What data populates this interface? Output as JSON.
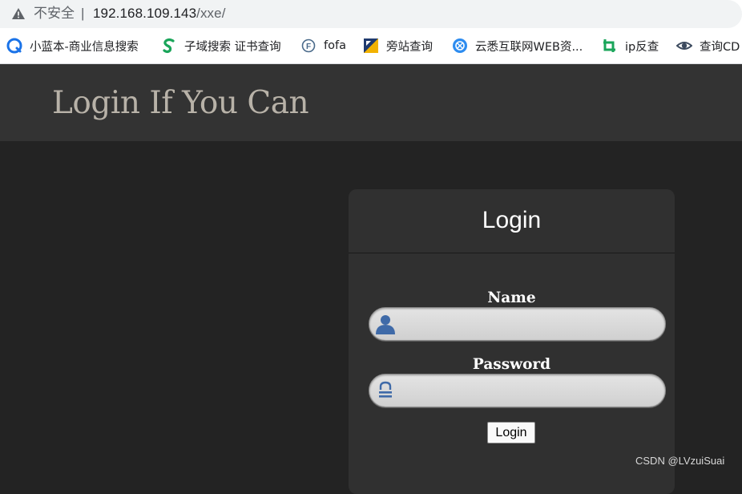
{
  "browser": {
    "security_label": "不安全",
    "separator": "|",
    "url_host": "192.168.109.143",
    "url_path": "/xxe/"
  },
  "bookmarks": [
    {
      "label": "小蓝本-商业信息搜索",
      "icon": "xiaolanben-icon"
    },
    {
      "label": "子域搜索 证书查询",
      "icon": "subdomain-search-icon"
    },
    {
      "label": "fofa",
      "icon": "fofa-icon"
    },
    {
      "label": "旁站查询",
      "icon": "side-site-icon"
    },
    {
      "label": "云悉互联网WEB资...",
      "icon": "yunxi-icon"
    },
    {
      "label": "ip反查",
      "icon": "ip-reverse-icon"
    },
    {
      "label": "查询CD",
      "icon": "eye-icon"
    }
  ],
  "site": {
    "title": "Login If You Can"
  },
  "login": {
    "heading": "Login",
    "name_label": "Name",
    "name_value": "",
    "password_label": "Password",
    "password_value": "",
    "button_label": "Login"
  },
  "watermark": "CSDN @LVzuiSuai",
  "colors": {
    "header_bg": "#333333",
    "page_bg": "#232323",
    "panel_bg": "#303030",
    "title_color": "#b8b2a8",
    "icon_blue": "#3f6aa8"
  }
}
